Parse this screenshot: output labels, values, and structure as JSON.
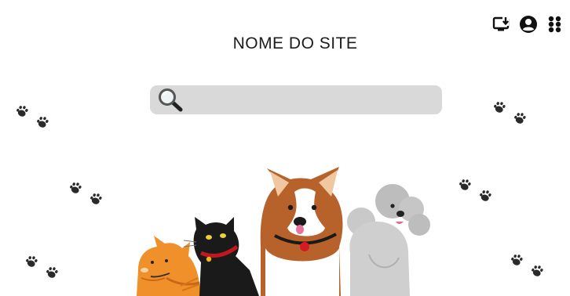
{
  "header": {
    "site_title": "NOME DO SITE",
    "icons": [
      "install-app-icon",
      "account-icon",
      "apps-menu-icon"
    ]
  },
  "search": {
    "value": "",
    "placeholder": ""
  },
  "decor": {
    "paw_color": "#2a2a2a",
    "search_bg": "#d9d9d9"
  }
}
